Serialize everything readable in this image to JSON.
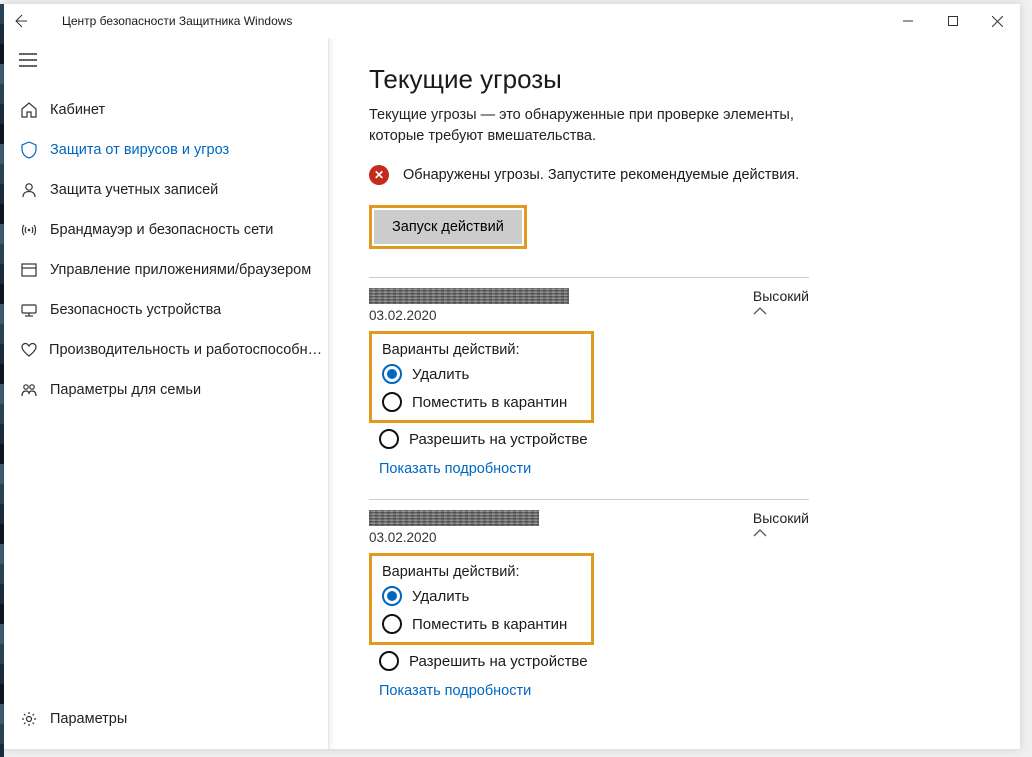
{
  "window": {
    "title": "Центр безопасности Защитника Windows"
  },
  "sidebar": {
    "items": [
      {
        "icon": "home",
        "label": "Кабинет"
      },
      {
        "icon": "shield",
        "label": "Защита от вирусов и угроз",
        "active": true
      },
      {
        "icon": "person",
        "label": "Защита учетных записей"
      },
      {
        "icon": "wifi",
        "label": "Брандмауэр и безопасность сети"
      },
      {
        "icon": "app",
        "label": "Управление приложениями/браузером"
      },
      {
        "icon": "device",
        "label": "Безопасность устройства"
      },
      {
        "icon": "heart",
        "label": "Производительность и работоспособность"
      },
      {
        "icon": "family",
        "label": "Параметры для семьи"
      }
    ],
    "footer": {
      "icon": "gear",
      "label": "Параметры"
    }
  },
  "main": {
    "heading": "Текущие угрозы",
    "description": "Текущие угрозы — это обнаруженные при проверке элементы, которые требуют вмешательства.",
    "status": "Обнаружены угрозы. Запустите рекомендуемые действия.",
    "run_button": "Запуск действий",
    "threats": [
      {
        "date": "03.02.2020",
        "severity": "Высокий",
        "options_title": "Варианты действий:",
        "opt_delete": "Удалить",
        "opt_quarantine": "Поместить в карантин",
        "opt_allow": "Разрешить на устройстве",
        "details": "Показать подробности"
      },
      {
        "date": "03.02.2020",
        "severity": "Высокий",
        "options_title": "Варианты действий:",
        "opt_delete": "Удалить",
        "opt_quarantine": "Поместить в карантин",
        "opt_allow": "Разрешить на устройстве",
        "details": "Показать подробности"
      }
    ]
  }
}
